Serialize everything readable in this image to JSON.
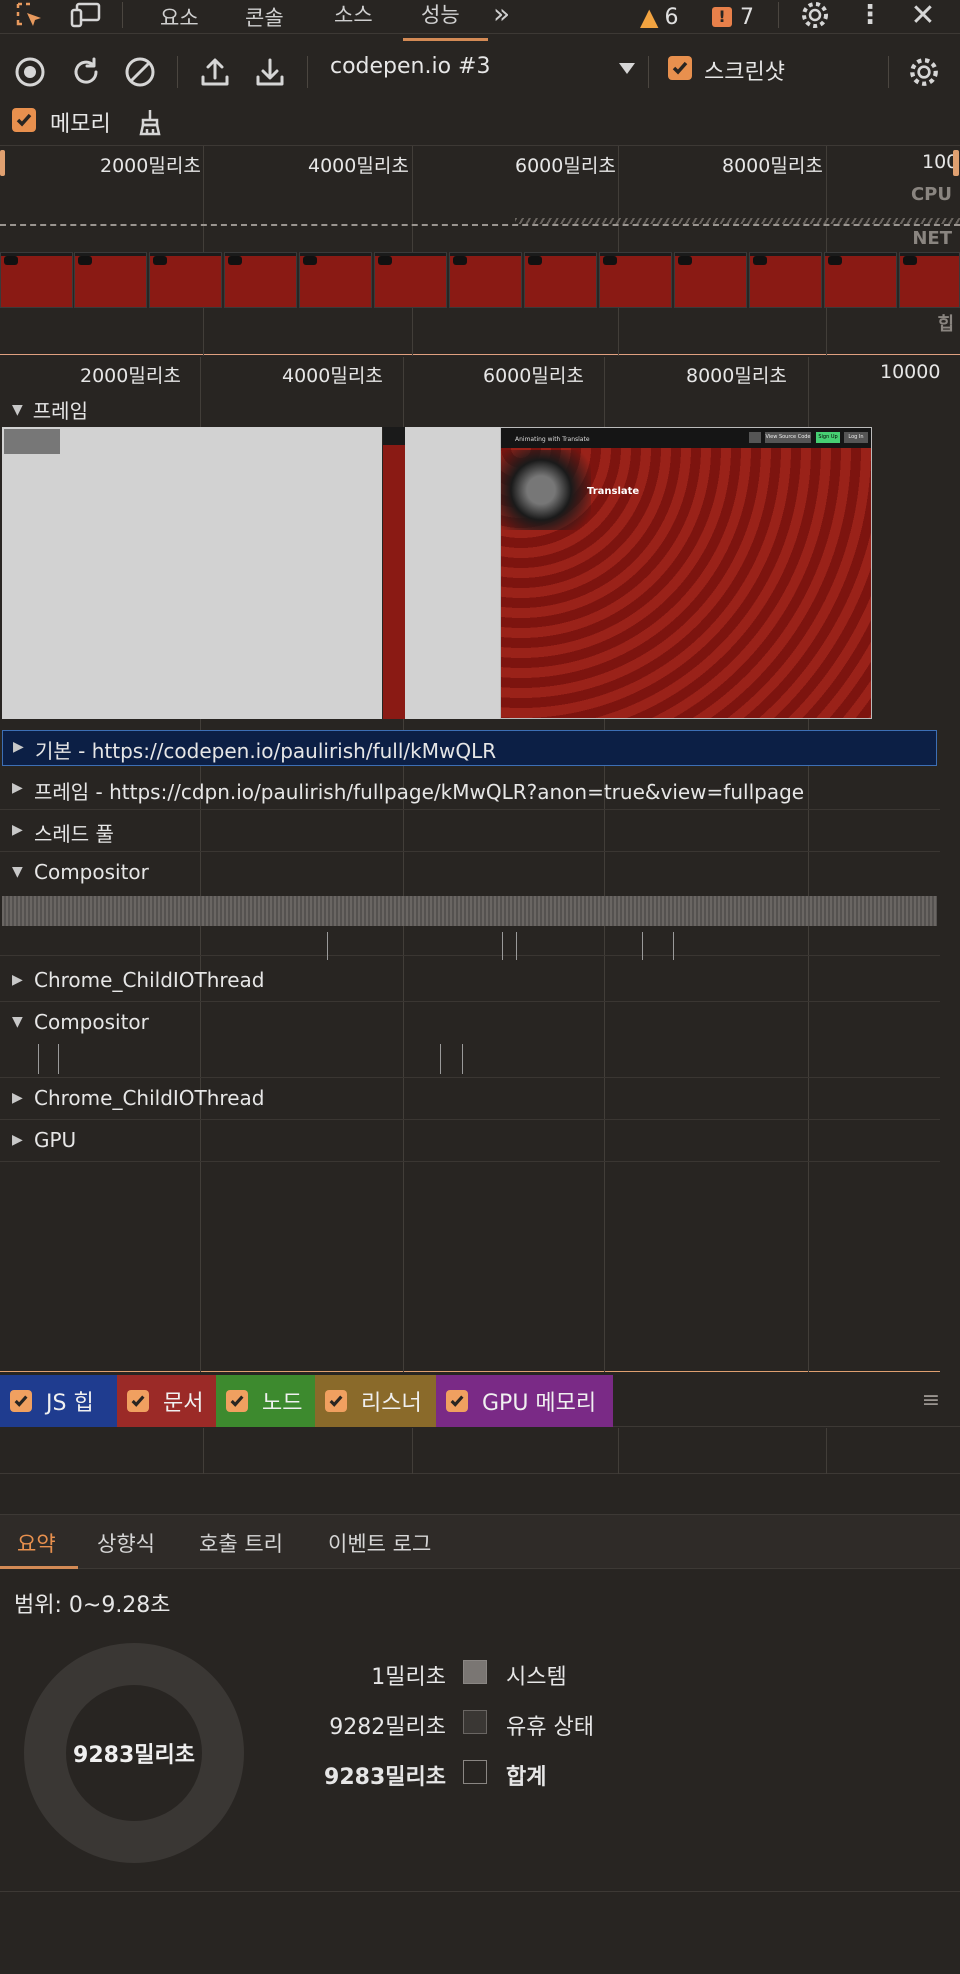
{
  "tabs": {
    "items": [
      {
        "label": "요소"
      },
      {
        "label": "콘솔"
      },
      {
        "label": "소스"
      },
      {
        "label": "성능"
      }
    ],
    "more": "»",
    "warnings": "6",
    "errors": "7"
  },
  "toolbar": {
    "profile_select": "codepen.io #3",
    "screenshot_label": "스크린샷",
    "screenshot_checked": true,
    "memory_label": "메모리",
    "memory_checked": true
  },
  "overview": {
    "ticks": [
      "2000밀리초",
      "4000밀리초",
      "6000밀리초",
      "8000밀리초",
      "100("
    ],
    "labels": {
      "cpu": "CPU",
      "net": "NET",
      "heap": "힙"
    }
  },
  "timeline": {
    "ticks": [
      "2000밀리초",
      "4000밀리초",
      "6000밀리초",
      "8000밀리초",
      "10000"
    ],
    "frames_label": "프레임",
    "frame_preview": {
      "header_small": "Animating with Translate",
      "buttons": [
        "View Source Code",
        "Sign Up",
        "Log In"
      ],
      "caption": "Translate"
    },
    "tracks": [
      {
        "label": "기본 - https://codepen.io/paulirish/full/kMwQLR",
        "expanded": false,
        "selected": true
      },
      {
        "label": "프레임 - https://cdpn.io/paulirish/fullpage/kMwQLR?anon=true&view=fullpage",
        "expanded": false
      },
      {
        "label": "스레드 풀",
        "expanded": false
      },
      {
        "label": "Compositor",
        "expanded": true
      },
      {
        "label": "Chrome_ChildIOThread",
        "expanded": false
      },
      {
        "label": "Compositor",
        "expanded": true
      },
      {
        "label": "Chrome_ChildIOThread",
        "expanded": false
      },
      {
        "label": "GPU",
        "expanded": false
      }
    ]
  },
  "memory_legend": [
    {
      "label": "JS 힙",
      "color": "#1f3c8f"
    },
    {
      "label": "문서",
      "color": "#9b2a27"
    },
    {
      "label": "노드",
      "color": "#3d8a2e"
    },
    {
      "label": "리스너",
      "color": "#8a6a2a"
    },
    {
      "label": "GPU 메모리",
      "color": "#7a2a86"
    }
  ],
  "bottom_tabs": [
    {
      "label": "요약"
    },
    {
      "label": "상향식"
    },
    {
      "label": "호출 트리"
    },
    {
      "label": "이벤트 로그"
    }
  ],
  "summary": {
    "range": "범위: 0~9.28초",
    "total_center": "9283밀리초",
    "rows": [
      {
        "value": "1밀리초",
        "label": "시스템",
        "color": "#7a7673"
      },
      {
        "value": "9282밀리초",
        "label": "유휴 상태",
        "color": "#3a3734"
      },
      {
        "value": "9283밀리초",
        "label": "합계",
        "color": "#282522",
        "bold": true
      }
    ]
  }
}
